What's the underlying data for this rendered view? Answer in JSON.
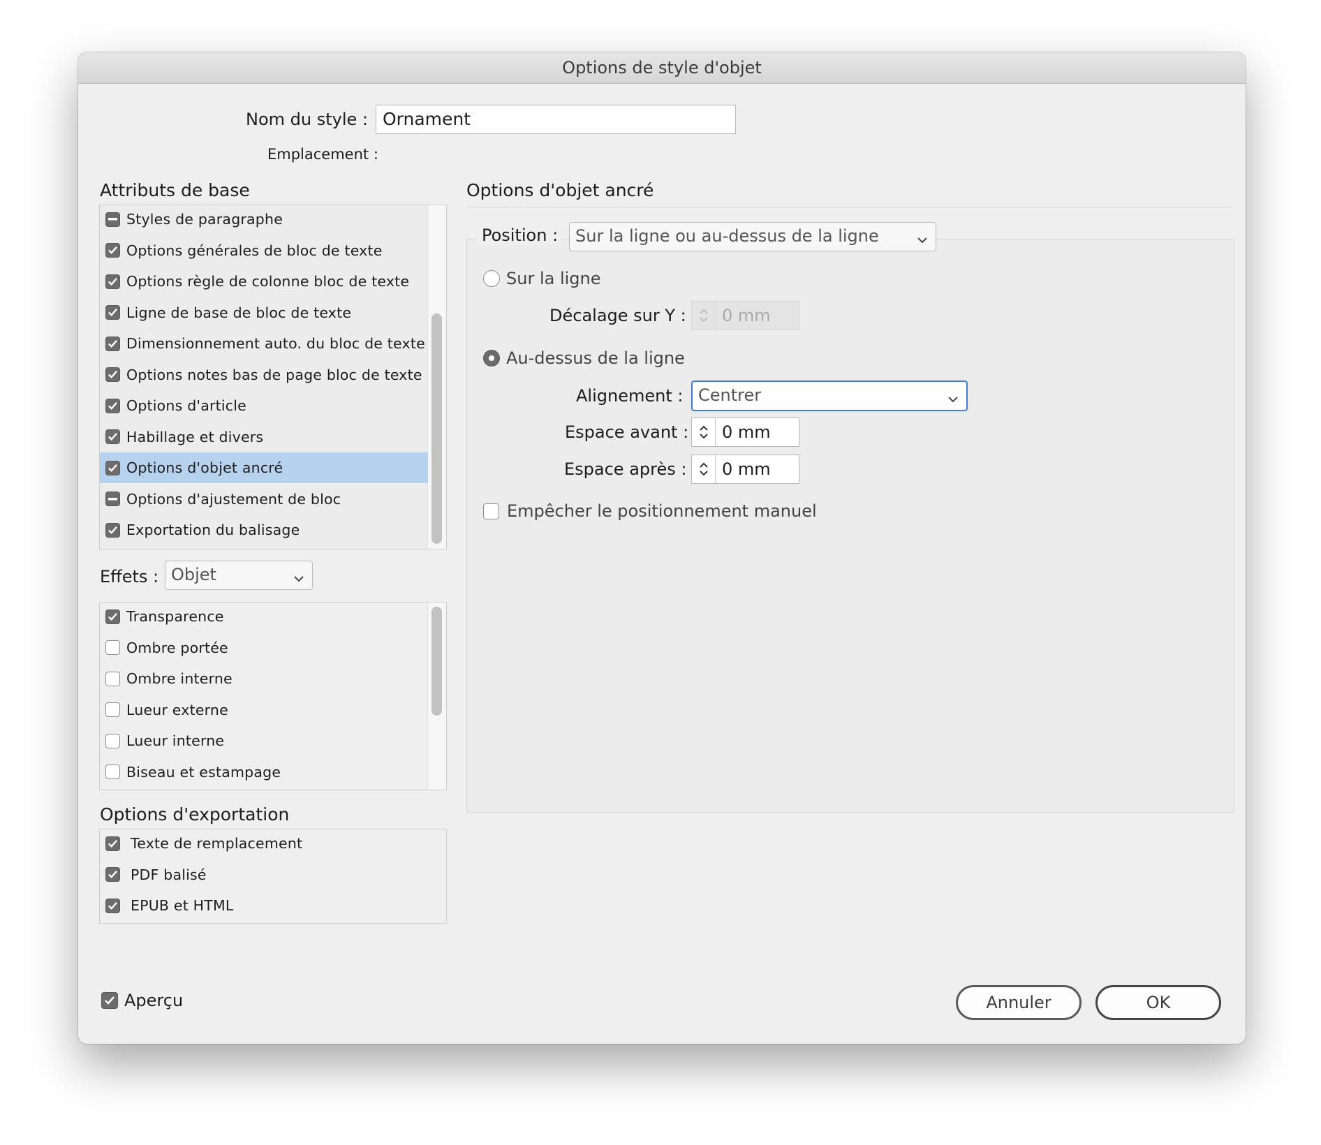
{
  "window": {
    "title": "Options de style d'objet"
  },
  "style_name": {
    "label": "Nom du style :",
    "value": "Ornament"
  },
  "location": {
    "label": "Emplacement :"
  },
  "basic_attributes": {
    "title": "Attributs de base",
    "items": [
      {
        "label": "Styles de paragraphe",
        "state": "mixed"
      },
      {
        "label": "Options générales de bloc de texte",
        "state": "on"
      },
      {
        "label": "Options règle de colonne bloc de texte",
        "state": "on"
      },
      {
        "label": "Ligne de base de bloc de texte",
        "state": "on"
      },
      {
        "label": "Dimensionnement auto. du bloc de texte",
        "state": "on"
      },
      {
        "label": "Options notes bas de page bloc de texte",
        "state": "on"
      },
      {
        "label": "Options d'article",
        "state": "on"
      },
      {
        "label": "Habillage et divers",
        "state": "on"
      },
      {
        "label": "Options d'objet ancré",
        "state": "on",
        "selected": true
      },
      {
        "label": "Options d'ajustement de bloc",
        "state": "mixed"
      },
      {
        "label": "Exportation du balisage",
        "state": "on"
      }
    ]
  },
  "effects": {
    "label": "Effets :",
    "selected": "Objet",
    "items": [
      {
        "label": "Transparence",
        "state": "on"
      },
      {
        "label": "Ombre portée",
        "state": "off"
      },
      {
        "label": "Ombre interne",
        "state": "off"
      },
      {
        "label": "Lueur externe",
        "state": "off"
      },
      {
        "label": "Lueur interne",
        "state": "off"
      },
      {
        "label": "Biseau et estampage",
        "state": "off"
      }
    ]
  },
  "export_options": {
    "title": "Options d'exportation",
    "items": [
      {
        "label": "Texte de remplacement",
        "state": "on"
      },
      {
        "label": "PDF balisé",
        "state": "on"
      },
      {
        "label": "EPUB et HTML",
        "state": "on"
      }
    ]
  },
  "anchored": {
    "title": "Options d'objet ancré",
    "position_label": "Position :",
    "position_value": "Sur la ligne ou au-dessus de la ligne",
    "inline_label": "Sur la ligne",
    "y_offset_label": "Décalage sur Y :",
    "y_offset_value": "0 mm",
    "above_label": "Au-dessus de la ligne",
    "alignment_label": "Alignement :",
    "alignment_value": "Centrer",
    "space_before_label": "Espace avant :",
    "space_before_value": "0 mm",
    "space_after_label": "Espace après :",
    "space_after_value": "0 mm",
    "prevent_manual_label": "Empêcher le positionnement manuel"
  },
  "preview": {
    "label": "Aperçu",
    "state": "on"
  },
  "buttons": {
    "cancel": "Annuler",
    "ok": "OK"
  },
  "colors": {
    "selection": "#b7d2ef",
    "focus_ring": "#3f7ed6",
    "checkbox_fill": "#6c6c6c"
  }
}
